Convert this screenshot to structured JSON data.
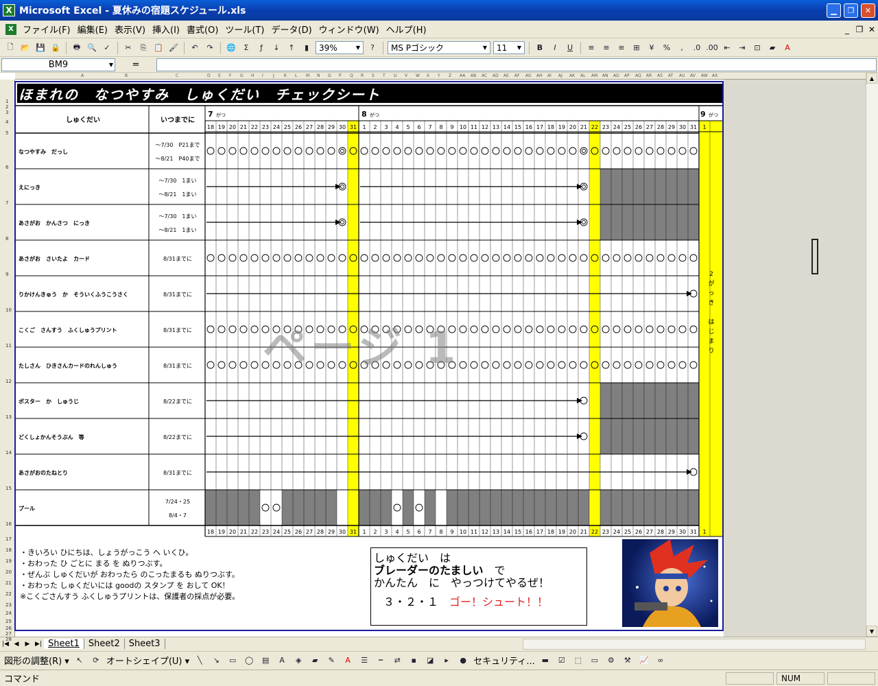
{
  "window": {
    "title": "Microsoft Excel - 夏休みの宿題スケジュール.xls",
    "app_icon": "X"
  },
  "menu": {
    "items": [
      "ファイル(F)",
      "編集(E)",
      "表示(V)",
      "挿入(I)",
      "書式(O)",
      "ツール(T)",
      "データ(D)",
      "ウィンドウ(W)",
      "ヘルプ(H)"
    ]
  },
  "toolbar": {
    "zoom": "39%",
    "font": "MS Pゴシック",
    "size": "11"
  },
  "formula": {
    "namebox": "BM9",
    "fx": "="
  },
  "row_numbers": [
    "1",
    "2",
    "3",
    "4",
    "5",
    "6",
    "7",
    "8",
    "9",
    "10",
    "11",
    "12",
    "13",
    "14",
    "15",
    "16",
    "17",
    "18",
    "19",
    "20",
    "21",
    "22",
    "23",
    "24",
    "25",
    "26",
    "27",
    "28"
  ],
  "sheet": {
    "title": "ほまれの　なつやすみ　しゅくだい　チェックシート",
    "hdr_task": "しゅくだい",
    "hdr_due": "いつまでに",
    "month7": "7",
    "month8": "8",
    "month9": "9",
    "month_unit": "がつ",
    "days": [
      "18",
      "19",
      "20",
      "21",
      "22",
      "23",
      "24",
      "25",
      "26",
      "27",
      "28",
      "29",
      "30",
      "31",
      "1",
      "2",
      "3",
      "4",
      "5",
      "6",
      "7",
      "8",
      "9",
      "10",
      "11",
      "12",
      "13",
      "14",
      "15",
      "16",
      "17",
      "18",
      "19",
      "20",
      "21",
      "22",
      "23",
      "24",
      "25",
      "26",
      "27",
      "28",
      "29",
      "30",
      "31",
      "1"
    ],
    "school_start": "2がっき　はじまり",
    "tasks": [
      {
        "name": "なつやすみ　だっし",
        "due1": "～7/30　P21まで",
        "due2": "～8/21　P40まで"
      },
      {
        "name": "えにっき",
        "due1": "～7/30　1まい",
        "due2": "～8/21　1まい"
      },
      {
        "name": "あさがお　かんさつ　にっき",
        "due1": "～7/30　1まい",
        "due2": "～8/21　1まい"
      },
      {
        "name": "あさがお　さいたよ　カード",
        "due1": "8/31までに",
        "due2": ""
      },
      {
        "name": "りかけんきゅう　か　そういくふうこうさく",
        "due1": "8/31までに",
        "due2": ""
      },
      {
        "name": "こくご　さんすう　ふくしゅうプリント",
        "due1": "8/31までに",
        "due2": ""
      },
      {
        "name": "たしさん　ひきさんカードのれんしゅう",
        "due1": "8/31までに",
        "due2": ""
      },
      {
        "name": "ポスター　か　しゅうじ",
        "due1": "8/22までに",
        "due2": ""
      },
      {
        "name": "どくしょかんそうぶん　等",
        "due1": "8/22までに",
        "due2": ""
      },
      {
        "name": "あさがおのたねとり",
        "due1": "8/31までに",
        "due2": ""
      },
      {
        "name": "プール",
        "due1": "7/24・25",
        "due2": "8/4・7"
      }
    ],
    "notes": [
      "・きいろい ひにちは、しょうがっこう へ いくひ。",
      "・おわった ひ ごとに まる を ぬりつぶす。",
      "・ぜんぶ しゅくだいが おわったら のこったまるも ぬりつぶす。",
      "・おわった しゅくだいには goodの スタンプ を おして OK！",
      "",
      "※こくごさんすう ふくしゅうプリントは、保護者の採点が必要。"
    ],
    "speech": {
      "l1": "しゅくだい　は",
      "l2": "ブレーダーのたましい",
      "l2b": "　で",
      "l3": "かんたん　に　やっつけてやるぜ！",
      "l4a": "３・２・１　",
      "l4b": "ゴー！シュート！！"
    },
    "watermark": "ページ 1"
  },
  "tabs": [
    "Sheet1",
    "Sheet2",
    "Sheet3"
  ],
  "drawbar": {
    "adjust": "図形の調整(R) ▾",
    "autoshape": "オートシェイプ(U) ▾",
    "security": "セキュリティ..."
  },
  "status": {
    "left": "コマンド",
    "num": "NUM"
  },
  "colors": {
    "title_blue": "#0a3fb0",
    "yellow": "#ffff00",
    "grey_fill": "#808080",
    "page_border": "#1a1aa0"
  }
}
